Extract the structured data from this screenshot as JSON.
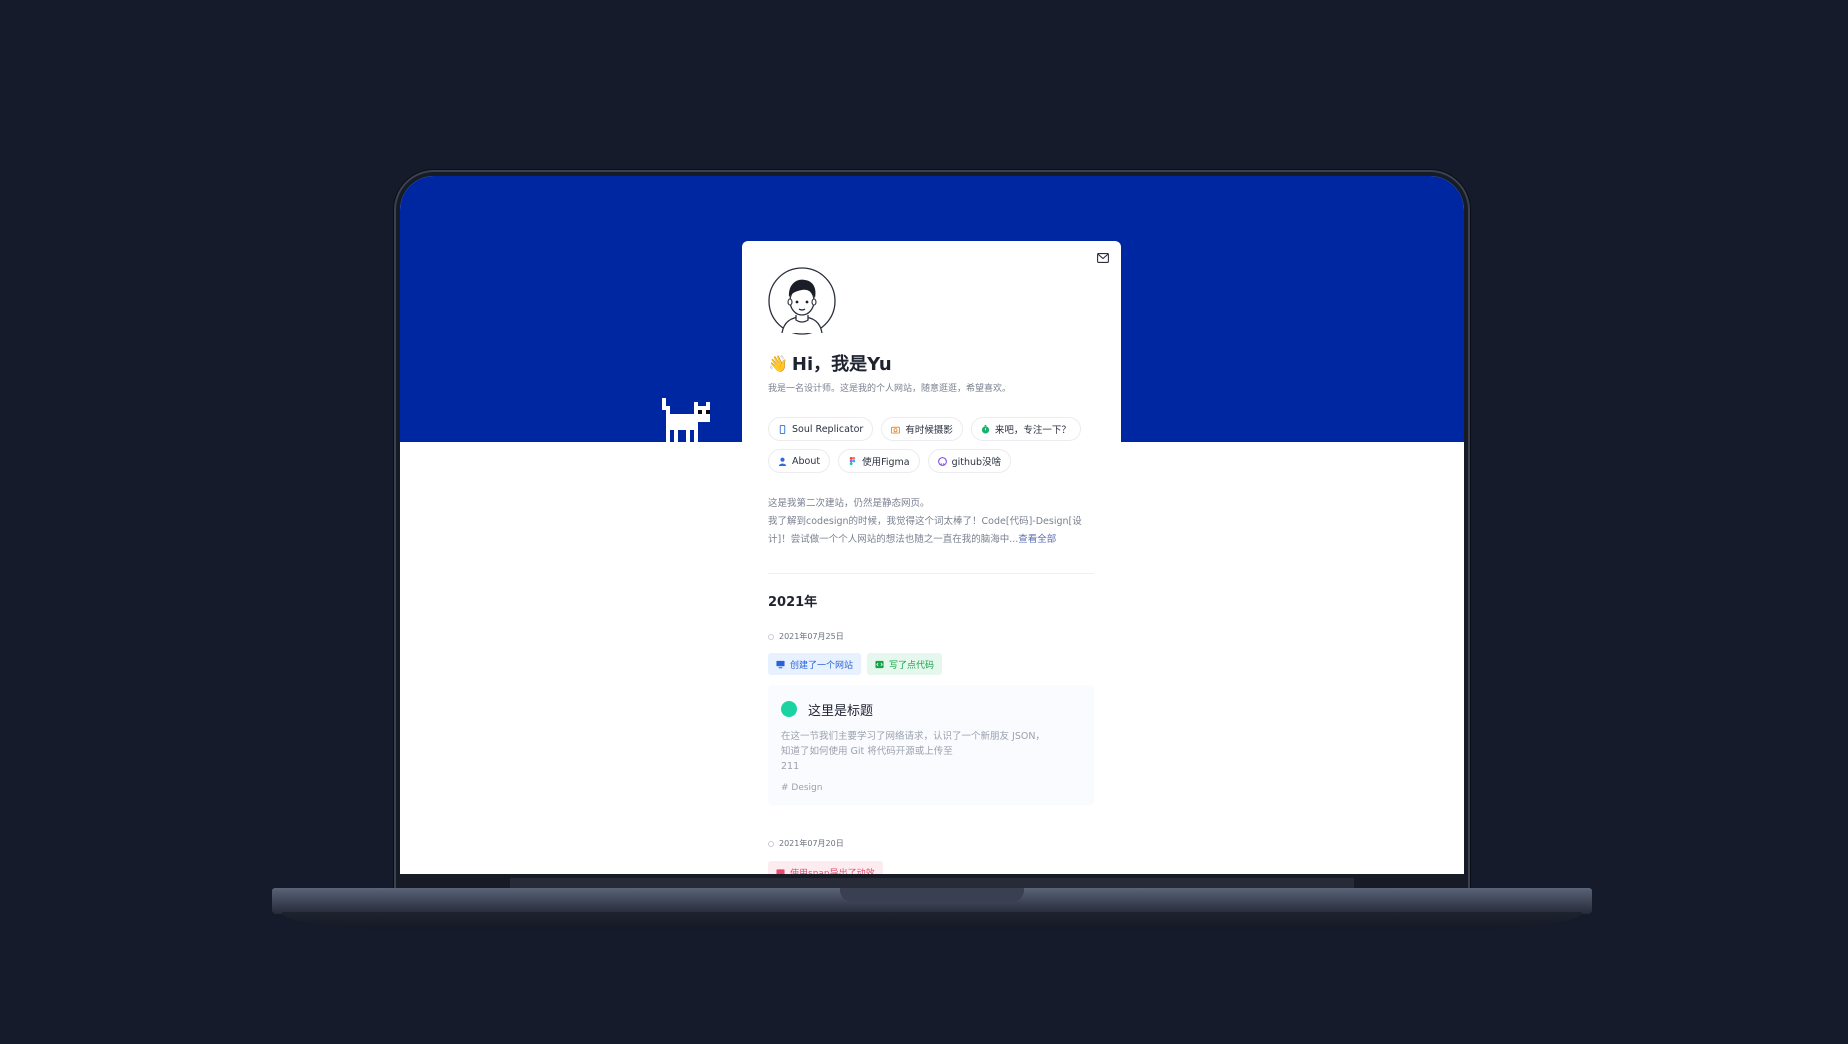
{
  "colors": {
    "banner": "#0027a2",
    "background": "#151b2a",
    "post_dot": "#19d3a3"
  },
  "profile": {
    "wave_emoji": "👋",
    "greeting": "Hi，我是Yu",
    "subtitle": "我是一名设计师。这是我的个人网站，随意逛逛，希望喜欢。",
    "mail_icon": "mail-icon"
  },
  "chips": [
    {
      "label": "Soul Replicator",
      "icon": "phone-icon"
    },
    {
      "label": "有时候摄影",
      "icon": "camera-icon"
    },
    {
      "label": "来吧，专注一下？",
      "icon": "timer-icon"
    },
    {
      "label": "About",
      "icon": "user-icon"
    },
    {
      "label": "使用Figma",
      "icon": "figma-icon"
    },
    {
      "label": "github没啥",
      "icon": "github-icon"
    }
  ],
  "intro": {
    "line1": "这是我第二次建站，仍然是静态网页。",
    "line2": "我了解到codesign的时候，我觉得这个词太棒了！Code[代码]-Design[设",
    "line3": "计]！尝试做一个个人网站的想法也随之一直在我的脑海中...",
    "more_link": "查看全部"
  },
  "timeline": {
    "year": "2021年",
    "entries": [
      {
        "date": "2021年07月25日",
        "tags": [
          {
            "label": "创建了一个网站",
            "color": "blue",
            "icon": "monitor-icon"
          },
          {
            "label": "写了点代码",
            "color": "green",
            "icon": "code-icon"
          }
        ],
        "post": {
          "title": "这里是标题",
          "body_line1": "在这一节我们主要学习了网络请求，认识了一个新朋友 JSON，",
          "body_line2": "知道了如何使用 Git 将代码开源或上传至",
          "body_line3": "211",
          "tag": "# Design"
        }
      },
      {
        "date": "2021年07月20日",
        "tags": [
          {
            "label": "使用snap导出了动效",
            "color": "pink",
            "icon": "calendar-icon"
          }
        ]
      }
    ]
  }
}
